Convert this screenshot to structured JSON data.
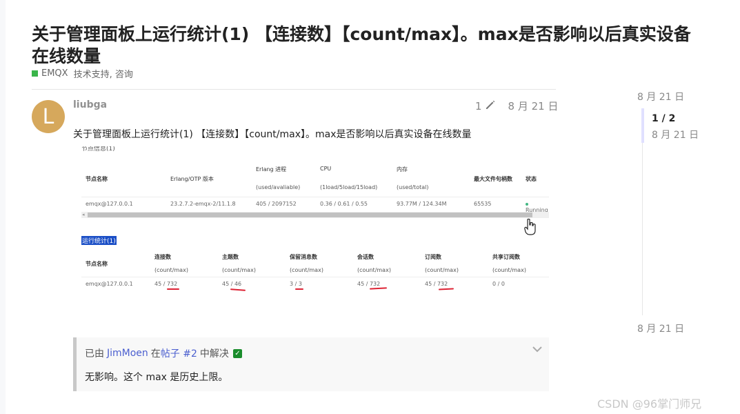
{
  "topic": {
    "title": "关于管理面板上运行统计(1) 【连接数】【count/max】。max是否影响以后真实设备在线数量",
    "category": "EMQX",
    "tags": "技术支持, 咨询"
  },
  "post": {
    "avatar_letter": "L",
    "username": "liubga",
    "edit_count": "1",
    "date": "8 月 21 日",
    "body": "关于管理面板上运行统计(1) 【连接数】【count/max】。max是否影响以后真实设备在线数量"
  },
  "screenshot": {
    "section1_cut": "节点信息(1)",
    "node_table": {
      "headers": [
        {
          "name": "节点名称",
          "sub": ""
        },
        {
          "name": "Erlang/OTP 版本",
          "sub": ""
        },
        {
          "name": "Erlang 进程",
          "sub": "(used/avaliable)"
        },
        {
          "name": "CPU",
          "sub": "(1load/5load/15load)"
        },
        {
          "name": "内存",
          "sub": "(used/total)"
        },
        {
          "name": "最大文件句柄数",
          "sub": ""
        },
        {
          "name": "状态",
          "sub": ""
        }
      ],
      "row": [
        "emqx@127.0.0.1",
        "23.2.7.2-emqx-2/11.1.8",
        "405 / 2097152",
        "0.36 / 0.61 / 0.55",
        "93.77M / 124.34M",
        "65535",
        "Running"
      ]
    },
    "section2_label": "运行统计(1)",
    "stats_table": {
      "headers": [
        {
          "name": "节点名称",
          "sub": ""
        },
        {
          "name": "连接数",
          "sub": "(count/max)"
        },
        {
          "name": "主题数",
          "sub": "(count/max)"
        },
        {
          "name": "保留消息数",
          "sub": "(count/max)"
        },
        {
          "name": "会话数",
          "sub": "(count/max)"
        },
        {
          "name": "订阅数",
          "sub": "(count/max)"
        },
        {
          "name": "共享订阅数",
          "sub": "(count/max)"
        }
      ],
      "row": [
        "emqx@127.0.0.1",
        "45 / 732",
        "45 / 46",
        "3 / 3",
        "45 / 732",
        "45 / 732",
        "0 / 0"
      ]
    },
    "scroll_arrow": "◂"
  },
  "timeline": {
    "top_date": "8 月 21 日",
    "counter": "1 / 2",
    "counter_date": "8 月 21 日",
    "bottom_date": "8 月 21 日"
  },
  "solution": {
    "prefix": "已由",
    "user": "JimMoen",
    "middle": "在",
    "post_link": "帖子 #2",
    "suffix": "中解决",
    "answer": "无影响。这个 max 是历史上限。"
  },
  "watermark": "CSDN @96掌门师兄"
}
